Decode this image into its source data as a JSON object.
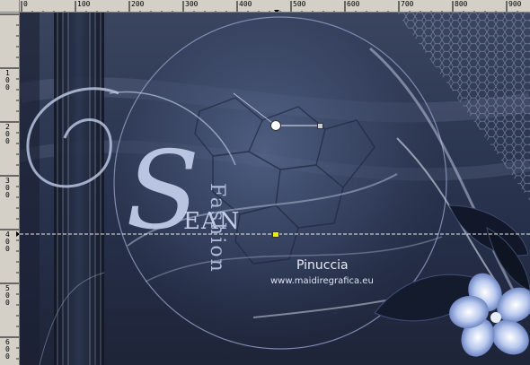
{
  "ruler_top": {
    "labels": [
      "0",
      "100",
      "200",
      "300",
      "400",
      "500",
      "600",
      "700",
      "800",
      "900"
    ]
  },
  "ruler_left": {
    "labels": [
      "100",
      "200",
      "300",
      "400",
      "500",
      "600"
    ]
  },
  "artwork": {
    "title_letter": "S",
    "title_rest": "EAN",
    "subtitle": "Fashion",
    "author": "Pinuccia",
    "website": "www.maidiregrafica.eu"
  },
  "colors": {
    "background": "#2d3852",
    "accent": "#b8c4e0",
    "guide_line": "#ffffff",
    "handle": "#e8f000"
  },
  "icons": [
    "rotation-handle-icon",
    "move-handle-icon",
    "flower-icon",
    "leaf-icon"
  ]
}
